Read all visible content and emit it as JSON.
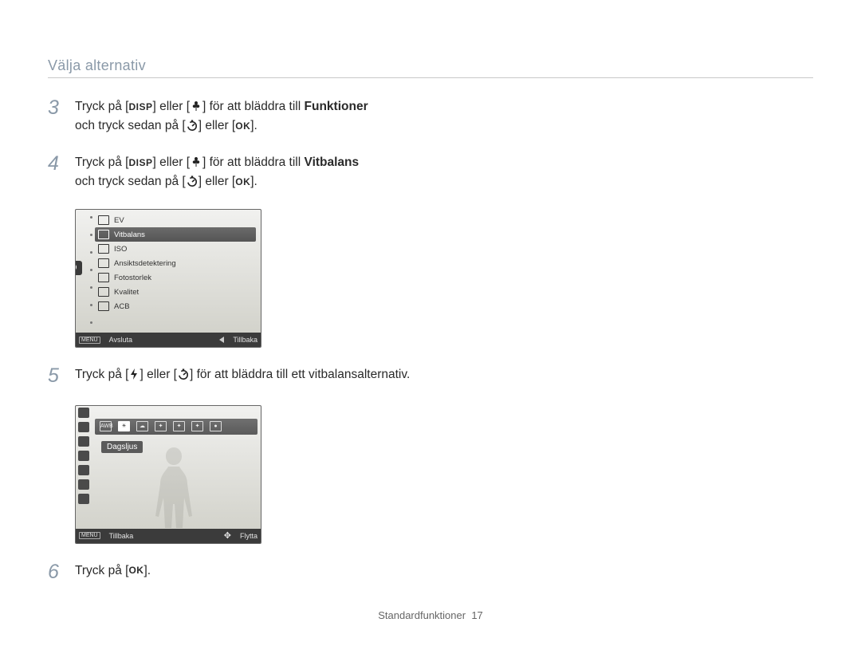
{
  "header": {
    "title": "Välja alternativ"
  },
  "buttons": {
    "disp": "DISP",
    "ok": "OK",
    "menu": "MENU"
  },
  "steps": {
    "s3": {
      "num": "3",
      "line1_a": "Tryck på [",
      "line1_b": "] eller [",
      "line1_c": "] för att bläddra till ",
      "line1_bold": "Funktioner",
      "line2_a": "och tryck sedan på [",
      "line2_b": "] eller [",
      "line2_c": "]."
    },
    "s4": {
      "num": "4",
      "line1_a": "Tryck på [",
      "line1_b": "] eller [",
      "line1_c": "] för att bläddra till ",
      "line1_bold": "Vitbalans",
      "line2_a": "och tryck sedan på [",
      "line2_b": "] eller [",
      "line2_c": "]."
    },
    "s5": {
      "num": "5",
      "line1_a": "Tryck på [",
      "line1_b": "] eller [",
      "line1_c": "] för att bläddra till ett vitbalansalternativ."
    },
    "s6": {
      "num": "6",
      "line1_a": "Tryck på [",
      "line1_b": "]."
    }
  },
  "lcd1": {
    "items": [
      "EV",
      "Vitbalans",
      "ISO",
      "Ansiktsdetektering",
      "Fotostorlek",
      "Kvalitet",
      "ACB"
    ],
    "icons": [
      "ev-icon",
      "awb-icon",
      "iso-icon",
      "face-icon",
      "size-icon",
      "quality-icon",
      "acb-icon"
    ],
    "selected_index": 1,
    "bottom": {
      "left": "Avsluta",
      "right": "Tillbaka"
    }
  },
  "lcd2": {
    "options": [
      "AWB",
      "☀",
      "☁",
      "✦",
      "✦",
      "✦",
      "●"
    ],
    "option_names": [
      "auto-wb",
      "daylight",
      "cloudy",
      "fluorescent-h",
      "fluorescent-l",
      "tungsten",
      "custom"
    ],
    "selected_index": 1,
    "selected_label": "Dagsljus",
    "left_icons": [
      "ev",
      "wb",
      "iso",
      "face",
      "m",
      "quality",
      "acb"
    ],
    "bottom": {
      "left": "Tillbaka",
      "right": "Flytta"
    }
  },
  "footer": {
    "section": "Standardfunktioner",
    "page": "17"
  }
}
